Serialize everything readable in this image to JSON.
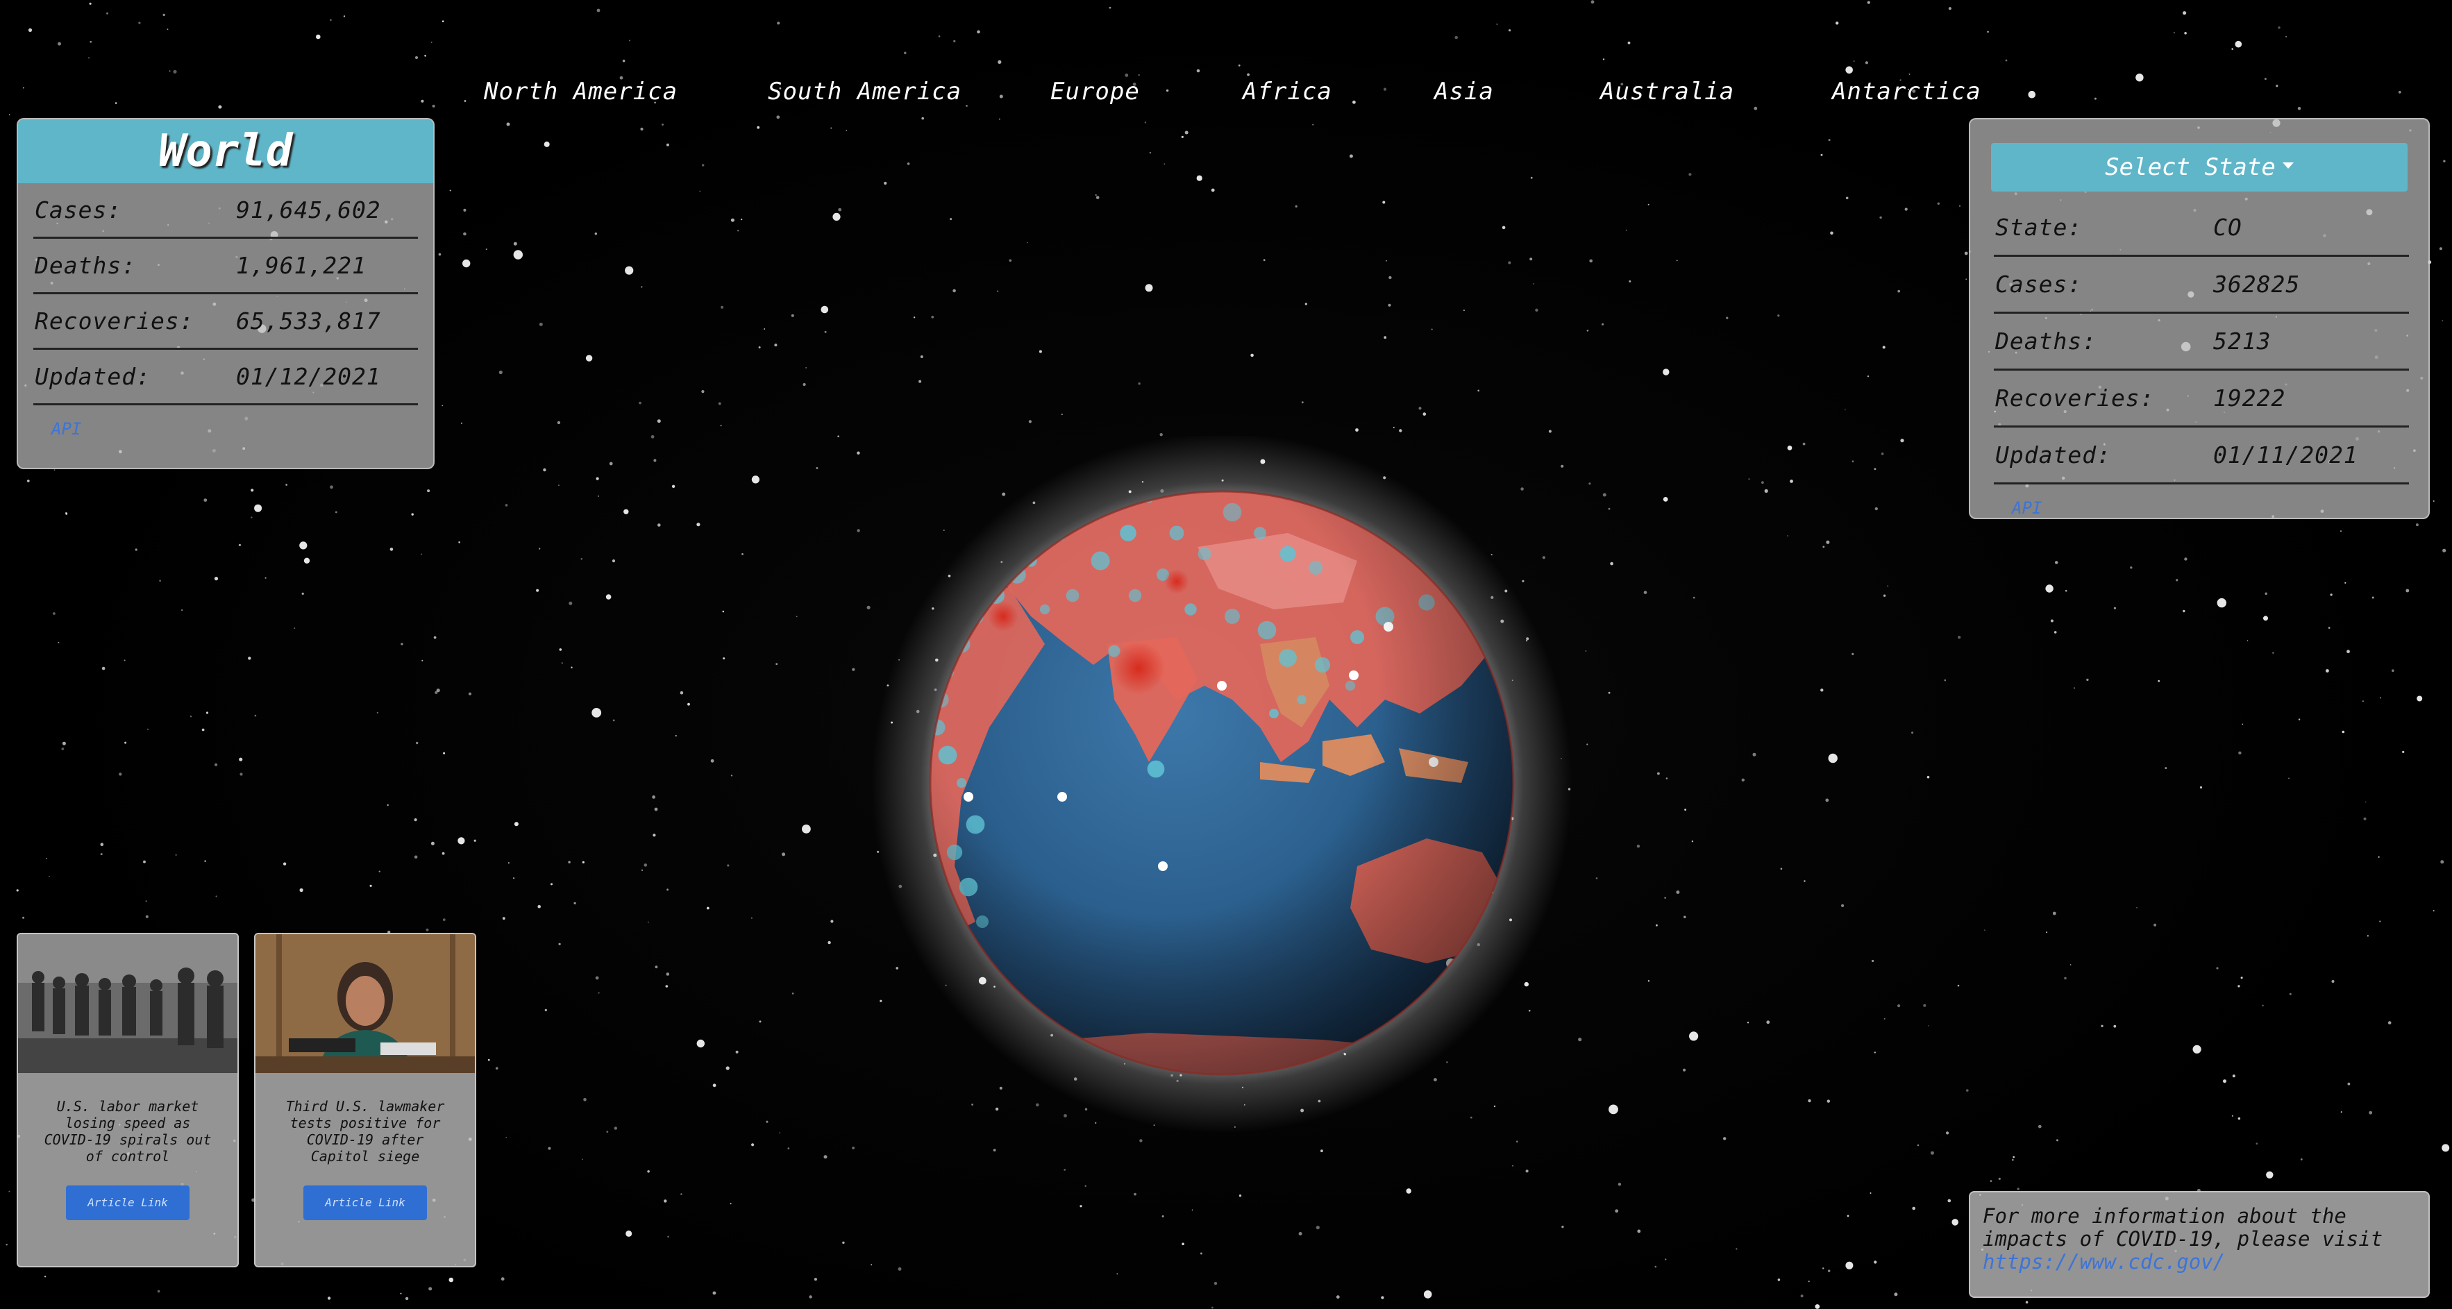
{
  "nav": {
    "continents": [
      "North America",
      "South America",
      "Europe",
      "Africa",
      "Asia",
      "Australia",
      "Antarctica"
    ]
  },
  "world_panel": {
    "title": "World",
    "stats": [
      {
        "label": "Cases:",
        "value": "91,645,602"
      },
      {
        "label": "Deaths:",
        "value": "1,961,221"
      },
      {
        "label": "Recoveries:",
        "value": "65,533,817"
      },
      {
        "label": "Updated:",
        "value": "01/12/2021"
      }
    ],
    "api_link": "API"
  },
  "state_panel": {
    "dropdown_label": "Select State",
    "stats": [
      {
        "label": "State:",
        "value": "CO"
      },
      {
        "label": "Cases:",
        "value": "362825"
      },
      {
        "label": "Deaths:",
        "value": "5213"
      },
      {
        "label": "Recoveries:",
        "value": "19222"
      },
      {
        "label": "Updated:",
        "value": "01/11/2021"
      }
    ],
    "api_link": "API"
  },
  "news": [
    {
      "title": "U.S. labor market losing speed as COVID-19 spirals out of control",
      "button": "Article Link"
    },
    {
      "title": "Third U.S. lawmaker tests positive for COVID-19 after Capitol siege",
      "button": "Article Link"
    }
  ],
  "info": {
    "text": "For more information about the impacts of COVID-19, please visit",
    "link": "https://www.cdc.gov/"
  },
  "colors": {
    "panel_header": "#5fb6c9",
    "link": "#3d74d8",
    "button": "#2f6fd3",
    "ocean": "#2b5f8d",
    "land": "#e4675a",
    "hotspot": "#c42a1e",
    "marker": "#5fc3d4"
  }
}
